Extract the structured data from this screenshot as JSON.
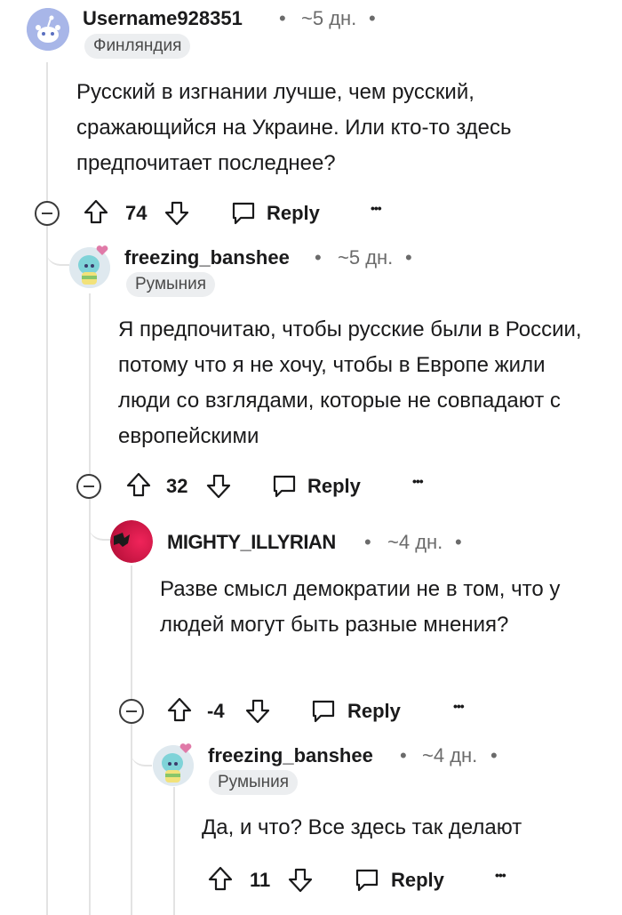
{
  "comments": [
    {
      "username": "Username928351",
      "time": "~5 дн.",
      "flair": "Финляндия",
      "body": "Русский в изгнании лучше, чем русский, сражающийся на Украине. Или кто-то здесь предпочитает последнее?",
      "score": "74",
      "reply_label": "Reply",
      "more_label": "•••"
    },
    {
      "username": "freezing_banshee",
      "time": "~5 дн.",
      "flair": "Румыния",
      "body": "Я предпочитаю, чтобы русские были в России, потому что я не хочу, чтобы в Европе жили люди со взглядами, которые не совпадают с европейскими",
      "score": "32",
      "reply_label": "Reply",
      "more_label": "•••"
    },
    {
      "username": "MIGHTY_ILLYRIAN",
      "time": "~4 дн.",
      "body": "Разве смысл демократии не в том, что у людей могут быть разные мнения?",
      "score": "-4",
      "reply_label": "Reply",
      "more_label": "•••"
    },
    {
      "username": "freezing_banshee",
      "time": "~4 дн.",
      "flair": "Румыния",
      "body": "Да, и что? Все здесь так делают",
      "score": "11",
      "reply_label": "Reply",
      "more_label": "•••"
    }
  ],
  "separator": "•",
  "colors": {
    "thread_line": "#e3e3e3",
    "flair_bg": "#eceef0",
    "meta": "#6b6b6b",
    "snoo_avatar_bg": "#a8b6e8"
  }
}
